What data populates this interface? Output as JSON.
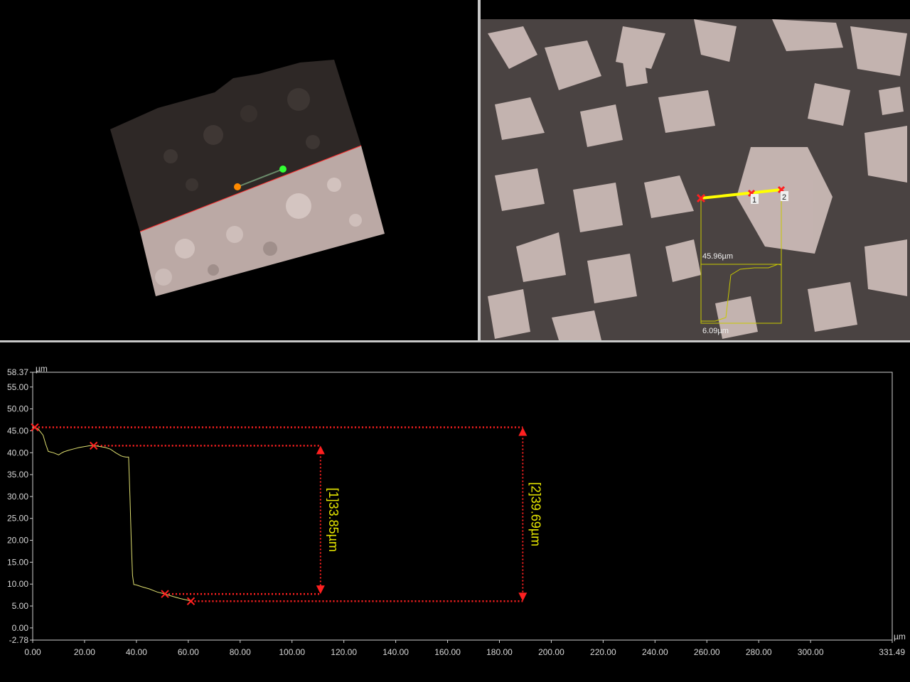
{
  "view3d": {
    "point_a_color": "#ff8a00",
    "point_b_color": "#33ff33",
    "profile_line_color": "#ff3030"
  },
  "optical": {
    "line_color": "#ffff00",
    "markers": [
      {
        "label": "1"
      },
      {
        "label": "2"
      }
    ],
    "inset": {
      "height_label": "45.96µm",
      "width_label": "6.09µm"
    }
  },
  "profile": {
    "y_unit": "µm",
    "x_unit": "µm",
    "y_ticks": [
      "58.37",
      "55.00",
      "50.00",
      "45.00",
      "40.00",
      "35.00",
      "30.00",
      "25.00",
      "20.00",
      "15.00",
      "10.00",
      "5.00",
      "0.00",
      "-2.78"
    ],
    "x_ticks": [
      "0.00",
      "20.00",
      "40.00",
      "60.00",
      "80.00",
      "100.00",
      "120.00",
      "140.00",
      "160.00",
      "180.00",
      "200.00",
      "220.00",
      "240.00",
      "260.00",
      "280.00",
      "300.00",
      "331.49"
    ],
    "measurements": [
      {
        "label": "[1]33.85µm",
        "top": 41.6,
        "bottom": 7.75,
        "x_start": 23.5,
        "x_end_top": 111,
        "x_start_bottom": 51,
        "x_end_bottom": 111,
        "arrow_x": 111
      },
      {
        "label": "[2]39.69µm",
        "top": 45.8,
        "bottom": 6.1,
        "x_start": 0.8,
        "x_end_top": 189,
        "x_start_bottom": 61,
        "x_end_bottom": 189,
        "arrow_x": 189
      }
    ],
    "curve_color": "#e0e070",
    "measure_color": "#ff2020"
  },
  "chart_data": {
    "type": "line",
    "title": "",
    "xlabel": "µm",
    "ylabel": "µm",
    "xlim": [
      0,
      331.49
    ],
    "ylim": [
      -2.78,
      58.37
    ],
    "x": [
      0.0,
      2,
      4,
      5,
      6,
      8,
      10,
      11,
      12,
      14,
      16,
      18,
      20,
      22,
      23.5,
      25,
      28,
      30,
      32,
      34,
      35,
      36,
      37,
      37.5,
      38,
      38.5,
      39,
      40,
      42,
      45,
      48,
      51,
      54,
      57,
      60,
      61
    ],
    "series": [
      {
        "name": "",
        "values": [
          45.8,
          45.5,
          44.0,
          42.0,
          40.3,
          40.0,
          39.5,
          39.9,
          40.2,
          40.6,
          40.9,
          41.2,
          41.4,
          41.6,
          41.6,
          41.5,
          41.2,
          40.8,
          40.0,
          39.3,
          39.1,
          39.0,
          39.0,
          30.0,
          20.0,
          12.0,
          9.9,
          9.8,
          9.4,
          8.9,
          8.2,
          7.75,
          7.2,
          6.7,
          6.3,
          6.1
        ]
      }
    ],
    "grid": false,
    "legend": "none"
  }
}
